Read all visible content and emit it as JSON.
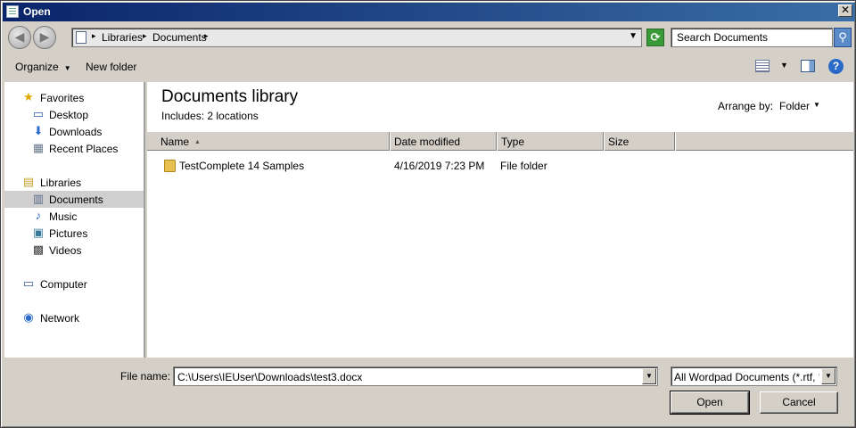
{
  "window": {
    "title": "Open"
  },
  "address": {
    "crumbs": [
      "Libraries",
      "Documents"
    ],
    "search_placeholder": "Search Documents"
  },
  "toolbar": {
    "organize_label": "Organize",
    "new_folder_label": "New folder",
    "help_glyph": "?"
  },
  "nav": {
    "favorites": {
      "label": "Favorites",
      "items": [
        "Desktop",
        "Downloads",
        "Recent Places"
      ]
    },
    "libraries": {
      "label": "Libraries",
      "items": [
        "Documents",
        "Music",
        "Pictures",
        "Videos"
      ]
    },
    "computer_label": "Computer",
    "network_label": "Network",
    "selected": "Documents"
  },
  "content": {
    "title": "Documents library",
    "includes_label": "Includes:",
    "includes_value": "2 locations",
    "arrange_label": "Arrange by:",
    "arrange_value": "Folder",
    "columns": [
      "Name",
      "Date modified",
      "Type",
      "Size"
    ],
    "rows": [
      {
        "name": "TestComplete 14 Samples",
        "date_modified": "4/16/2019 7:23 PM",
        "type": "File folder",
        "size": ""
      }
    ]
  },
  "bottom": {
    "filename_label": "File name:",
    "filename_value": "C:\\Users\\IEUser\\Downloads\\test3.docx",
    "filter_value": "All Wordpad Documents (*.rtf, *",
    "open_label": "Open",
    "cancel_label": "Cancel"
  },
  "colors": {
    "titlebar": "#0a246a",
    "selection": "#cfcfcf",
    "folder": "#e8c050"
  }
}
